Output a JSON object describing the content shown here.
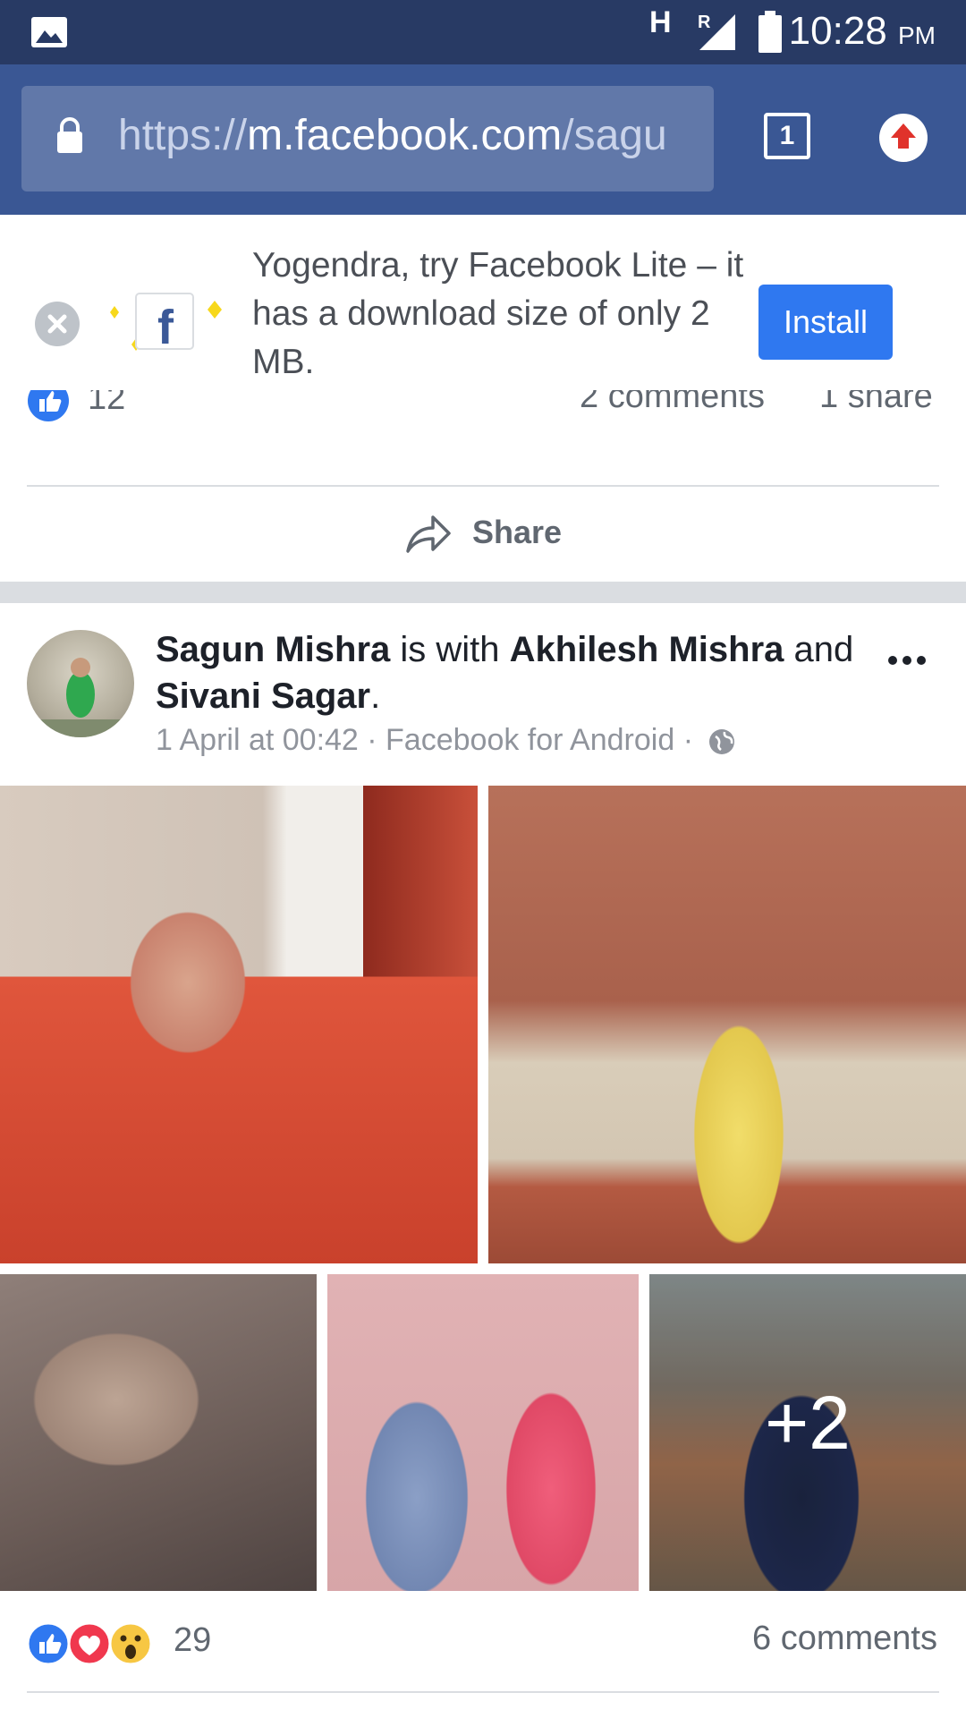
{
  "status_bar": {
    "network": "H",
    "roaming": "R",
    "time": "10:28",
    "ampm": "PM"
  },
  "browser": {
    "url_scheme": "https://",
    "url_host": "m.facebook.com",
    "url_path": "/sagu",
    "tab_count": "1"
  },
  "lite_banner": {
    "message": "Yogendra, try Facebook Lite – it has a download size of only 2 MB.",
    "install_label": "Install"
  },
  "post1": {
    "likes": "12",
    "comments": "2 comments",
    "shares": "1 share",
    "share_label": "Share"
  },
  "post2": {
    "author": "Sagun Mishra",
    "with_text": " is with ",
    "tagged1": "Akhilesh Mishra",
    "and_text": " and ",
    "tagged2": "Sivani Sagar",
    "end_text": ".",
    "meta": "1 April at 00:42 · Facebook for Android ·",
    "more_photos": "+2",
    "reaction_count": "29",
    "comment_count": "6 comments"
  },
  "colors": {
    "facebook_blue": "#3a5794",
    "status_bar": "#283a64",
    "install_blue": "#2f78f0",
    "like_blue": "#2f78f0",
    "love_red": "#f0384e",
    "wow_yellow": "#f7c743"
  }
}
